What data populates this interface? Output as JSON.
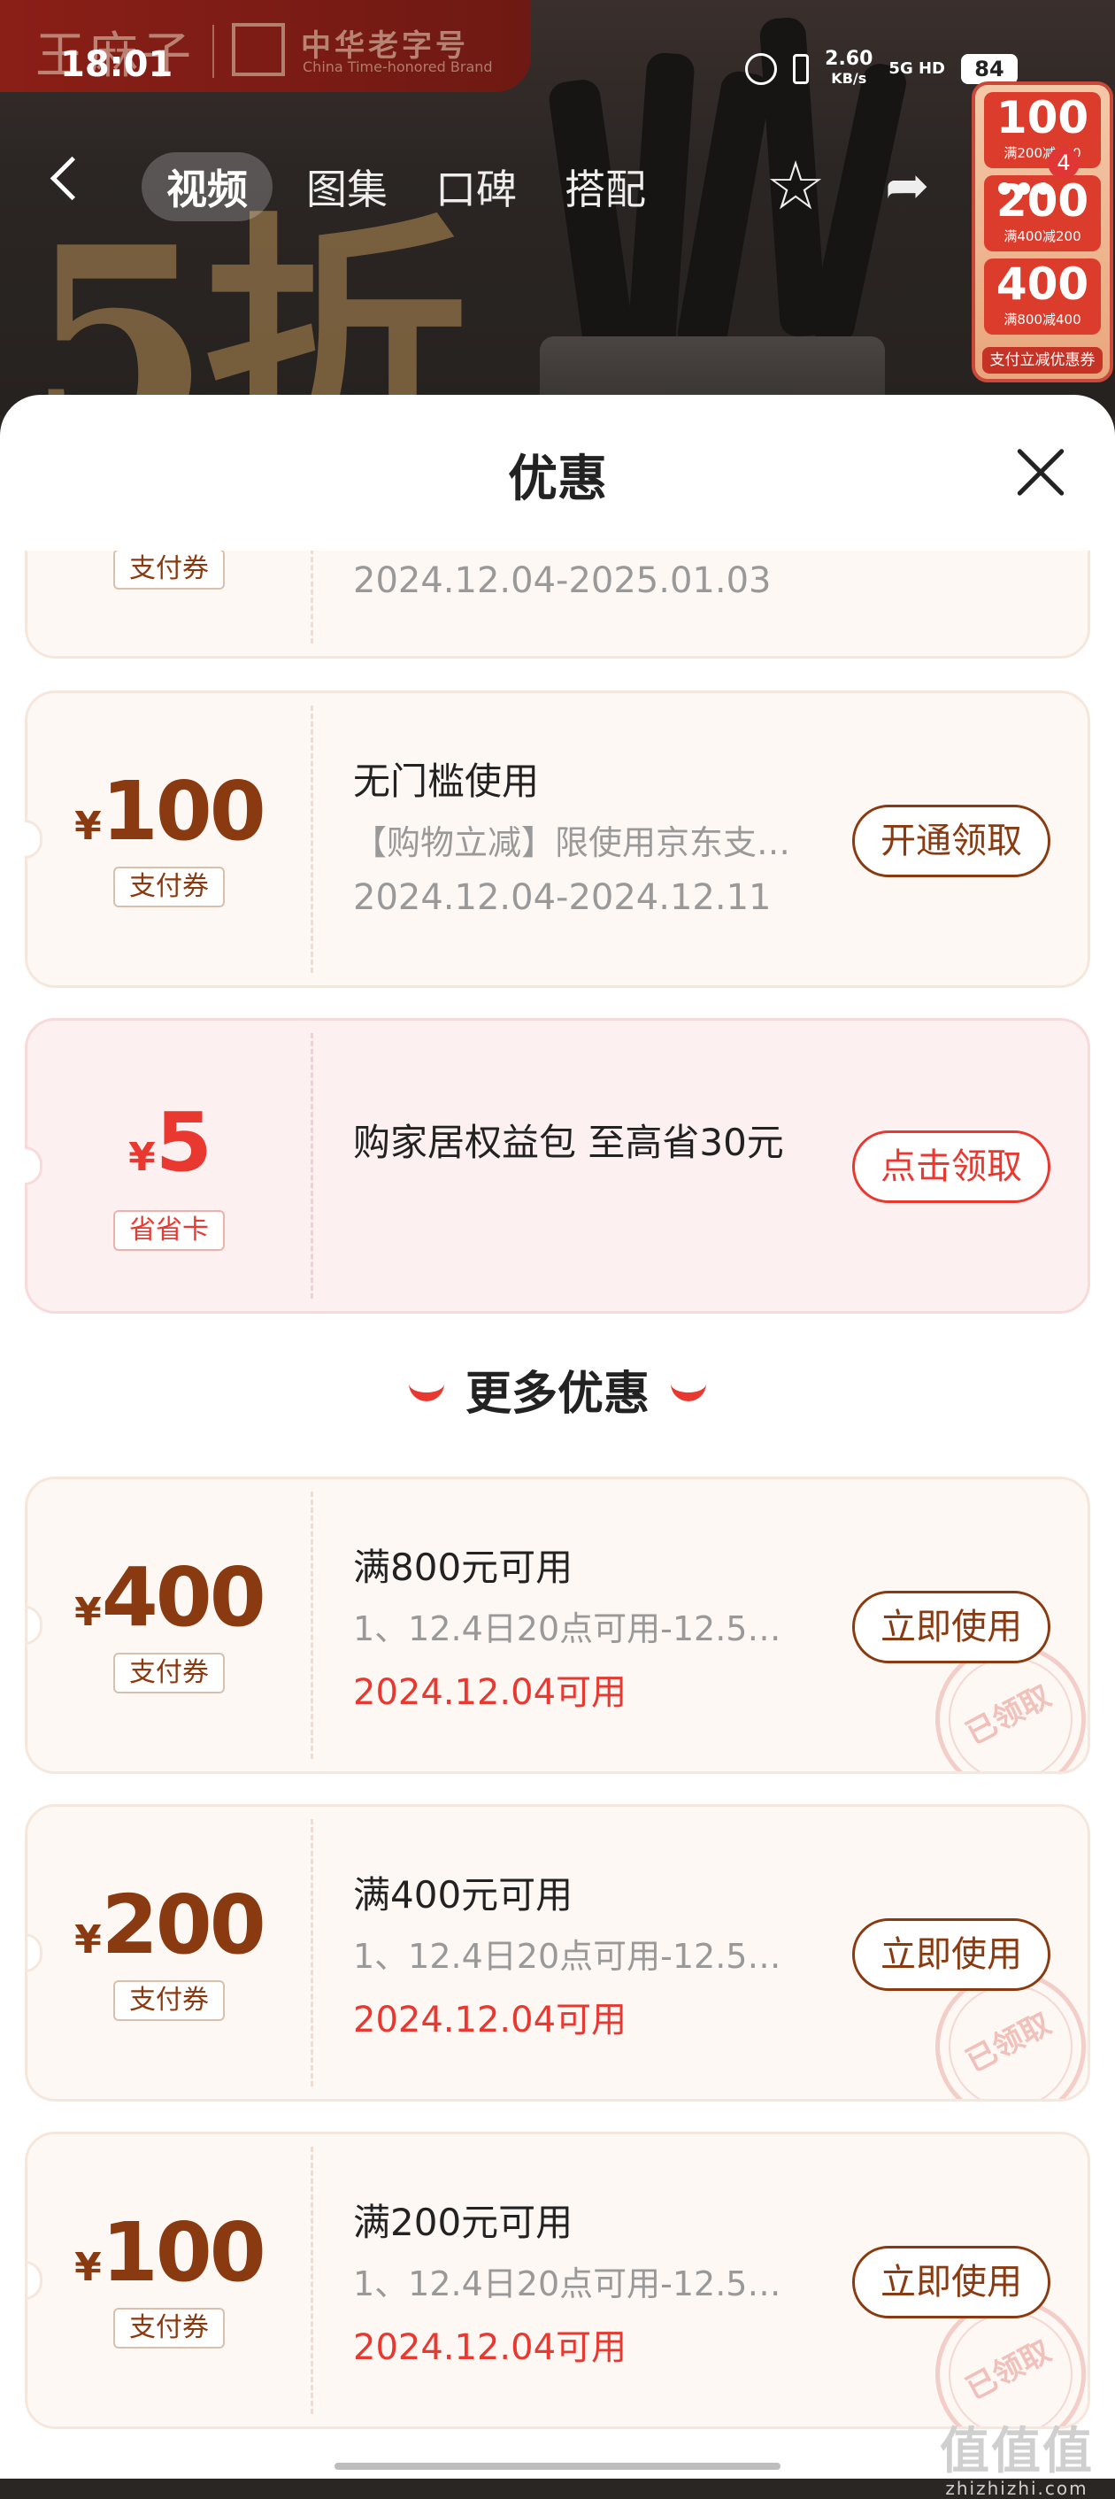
{
  "status_bar": {
    "time": "18:01",
    "net_speed": "2.60",
    "net_unit": "KB/s",
    "network": "5G HD",
    "battery": "84"
  },
  "brand": {
    "logo_text": "王麻子",
    "badge": "中华老字号",
    "badge_en": "China Time-honored Brand"
  },
  "hero": {
    "text": "5折"
  },
  "nav": {
    "tabs": [
      "视频",
      "图集",
      "口碑",
      "搭配"
    ],
    "active_tab": "视频"
  },
  "promo_card": {
    "items": [
      {
        "value": "100",
        "sub": "满200减100"
      },
      {
        "value": "200",
        "sub": "满400减200"
      },
      {
        "value": "400",
        "sub": "满800减400"
      }
    ],
    "footer": "支付立减优惠券",
    "badge_count": "4"
  },
  "sheet": {
    "title": "优惠"
  },
  "coupons": [
    {
      "yen": "¥",
      "amount": "",
      "tag": "支付券",
      "title": "",
      "desc": "",
      "date": "2024.12.04-2025.01.03",
      "button": ""
    },
    {
      "yen": "¥",
      "amount": "100",
      "tag": "支付券",
      "title": "无门槛使用",
      "desc": "【购物立减】限使用京东支…",
      "date": "2024.12.04-2024.12.11",
      "button": "开通领取"
    },
    {
      "yen": "¥",
      "amount": "5",
      "tag": "省省卡",
      "title": "购家居权益包 至高省30元",
      "button": "点击领取"
    }
  ],
  "more_section": {
    "title": "更多优惠"
  },
  "more_coupons": [
    {
      "yen": "¥",
      "amount": "400",
      "tag": "支付券",
      "title": "满800元可用",
      "desc": "1、12.4日20点可用-12.5…",
      "date": "2024.12.04可用",
      "button": "立即使用",
      "stamp": "已领取"
    },
    {
      "yen": "¥",
      "amount": "200",
      "tag": "支付券",
      "title": "满400元可用",
      "desc": "1、12.4日20点可用-12.5…",
      "date": "2024.12.04可用",
      "button": "立即使用",
      "stamp": "已领取"
    },
    {
      "yen": "¥",
      "amount": "100",
      "tag": "支付券",
      "title": "满200元可用",
      "desc": "1、12.4日20点可用-12.5…",
      "date": "2024.12.04可用",
      "button": "立即使用",
      "stamp": "已领取"
    }
  ],
  "watermark": {
    "text": "值值值",
    "sub": "zhizhizhi.com"
  },
  "colors": {
    "brown": "#8a3a10",
    "red": "#e8382f",
    "card_bg": "#fdf8f4",
    "pink_bg": "#fdf0f0"
  }
}
